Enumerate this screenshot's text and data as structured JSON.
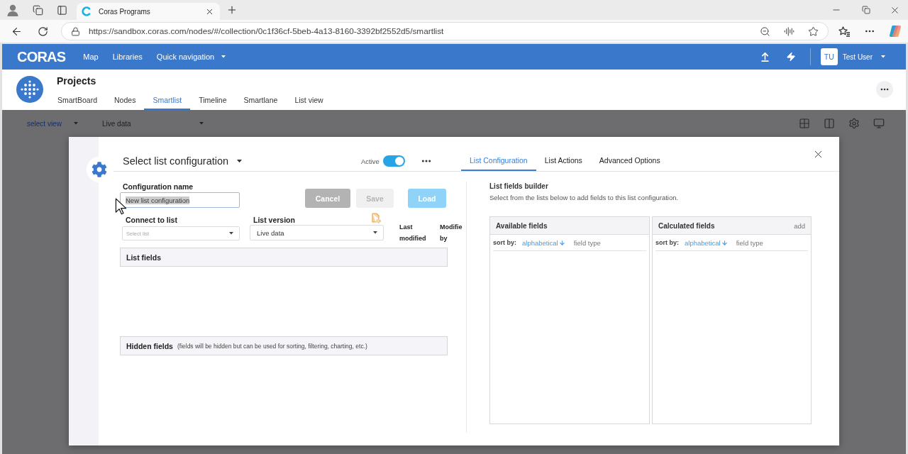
{
  "browser": {
    "tab": {
      "title": "Coras Programs"
    },
    "url": "https://sandbox.coras.com/nodes/#/collection/0c1f36cf-5beb-4a13-8160-3392bf2552d5/smartlist"
  },
  "app_header": {
    "logo": "CORAS",
    "nav": [
      {
        "label": "Map",
        "kind": "link"
      },
      {
        "label": "Libraries",
        "kind": "link"
      },
      {
        "label": "Quick navigation",
        "kind": "dropdown"
      }
    ],
    "user": {
      "initials": "TU",
      "name": "Test User"
    }
  },
  "page": {
    "title": "Projects",
    "tabs": [
      {
        "label": "SmartBoard",
        "selected": false
      },
      {
        "label": "Nodes",
        "selected": false
      },
      {
        "label": "Smartlist",
        "selected": true
      },
      {
        "label": "Timeline",
        "selected": false
      },
      {
        "label": "Smartlane",
        "selected": false
      },
      {
        "label": "List view",
        "selected": false
      }
    ]
  },
  "view_bar": {
    "view_select": {
      "placeholder": "select view"
    },
    "data_select": {
      "value": "Live data"
    }
  },
  "dialog": {
    "config_select": {
      "label": "Select list configuration"
    },
    "active": {
      "label": "Active",
      "on": true
    },
    "tabs": [
      {
        "label": "List Configuration",
        "selected": true
      },
      {
        "label": "List Actions",
        "selected": false
      },
      {
        "label": "Advanced Options",
        "selected": false
      }
    ],
    "form": {
      "name": {
        "label": "Configuration name",
        "value": "New list configuration",
        "text_selected": true
      },
      "buttons": [
        {
          "label": "Cancel",
          "kind": "neutral",
          "disabled": false
        },
        {
          "label": "Save",
          "kind": "default",
          "disabled": true
        },
        {
          "label": "Load",
          "kind": "primary",
          "disabled": true
        }
      ],
      "connect_to_list": {
        "label": "Connect to list",
        "placeholder": "Select list"
      },
      "list_version": {
        "label": "List version",
        "value": "Live data"
      },
      "columns": [
        "Last modified",
        "Modifie by"
      ],
      "list_fields": {
        "title": "List fields"
      },
      "hidden_fields": {
        "title": "Hidden fields",
        "note": "(fields will be hidden but can be used for sorting, filtering, charting, etc.)"
      }
    },
    "builder": {
      "title": "List fields builder",
      "description": "Select from the lists below to add fields to this list configuration.",
      "panels": [
        {
          "title": "Available fields",
          "sort_label": "sort by:",
          "sort_options": [
            {
              "label": "alphabetical",
              "selected": true
            },
            {
              "label": "field type",
              "selected": false
            }
          ]
        },
        {
          "title": "Calculated fields",
          "action": "add",
          "sort_label": "sort by:",
          "sort_options": [
            {
              "label": "alphabetical",
              "selected": true
            },
            {
              "label": "field type",
              "selected": false
            }
          ]
        }
      ]
    }
  }
}
